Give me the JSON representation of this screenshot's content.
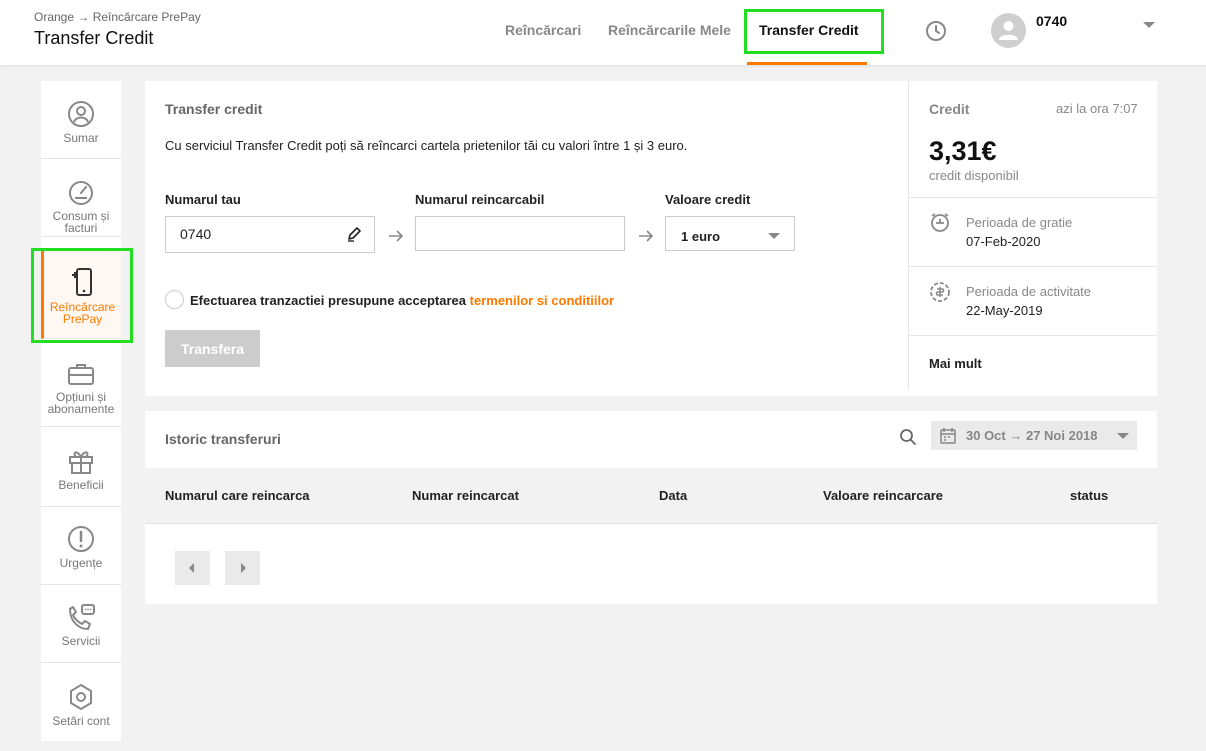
{
  "header": {
    "breadcrumb": "Orange → Reîncărcare PrePay",
    "title": "Transfer Credit",
    "tabs": [
      {
        "label": "Reîncărcari"
      },
      {
        "label": "Reîncărcarile Mele"
      },
      {
        "label": "Transfer Credit",
        "active": true
      }
    ],
    "user_number": "0740"
  },
  "sidebar": {
    "items": [
      {
        "label": "Sumar",
        "icon": "user-icon"
      },
      {
        "label": "Consum și facturi",
        "icon": "gauge-icon"
      },
      {
        "label": "Reîncărcare PrePay",
        "icon": "phone-recharge-icon",
        "active": true
      },
      {
        "label": "Opțiuni și abonamente",
        "icon": "briefcase-icon"
      },
      {
        "label": "Beneficii",
        "icon": "gift-icon"
      },
      {
        "label": "Urgențe",
        "icon": "alert-icon"
      },
      {
        "label": "Servicii",
        "icon": "phone-chat-icon"
      },
      {
        "label": "Setări cont",
        "icon": "settings-icon"
      }
    ]
  },
  "transfer": {
    "title": "Transfer credit",
    "description": "Cu serviciul Transfer Credit poți să reîncarci cartela prietenilor tăi cu valori între 1 și 3 euro.",
    "your_number_label": "Numarul tau",
    "your_number_value": "0740",
    "recipient_label": "Numarul reincarcabil",
    "recipient_value": "",
    "credit_value_label": "Valoare credit",
    "credit_value_selected": "1 euro",
    "terms_text": "Efectuarea tranzactiei presupune acceptarea",
    "terms_link": "termenilor si conditiilor",
    "submit_label": "Transfera"
  },
  "credit": {
    "label": "Credit",
    "time": "azi la ora 7:07",
    "amount": "3,31€",
    "available_label": "credit disponibil",
    "grace_label": "Perioada de gratie",
    "grace_date": "07-Feb-2020",
    "activity_label": "Perioada de activitate",
    "activity_date": "22-May-2019",
    "more_label": "Mai mult"
  },
  "history": {
    "title": "Istoric transferuri",
    "date_range": "30 Oct → 27 Noi 2018",
    "columns": [
      "Numarul care reincarca",
      "Numar reincarcat",
      "Data",
      "Valoare reincarcare",
      "status"
    ]
  },
  "colors": {
    "accent": "#ff7900",
    "highlight": "#22dd22"
  }
}
